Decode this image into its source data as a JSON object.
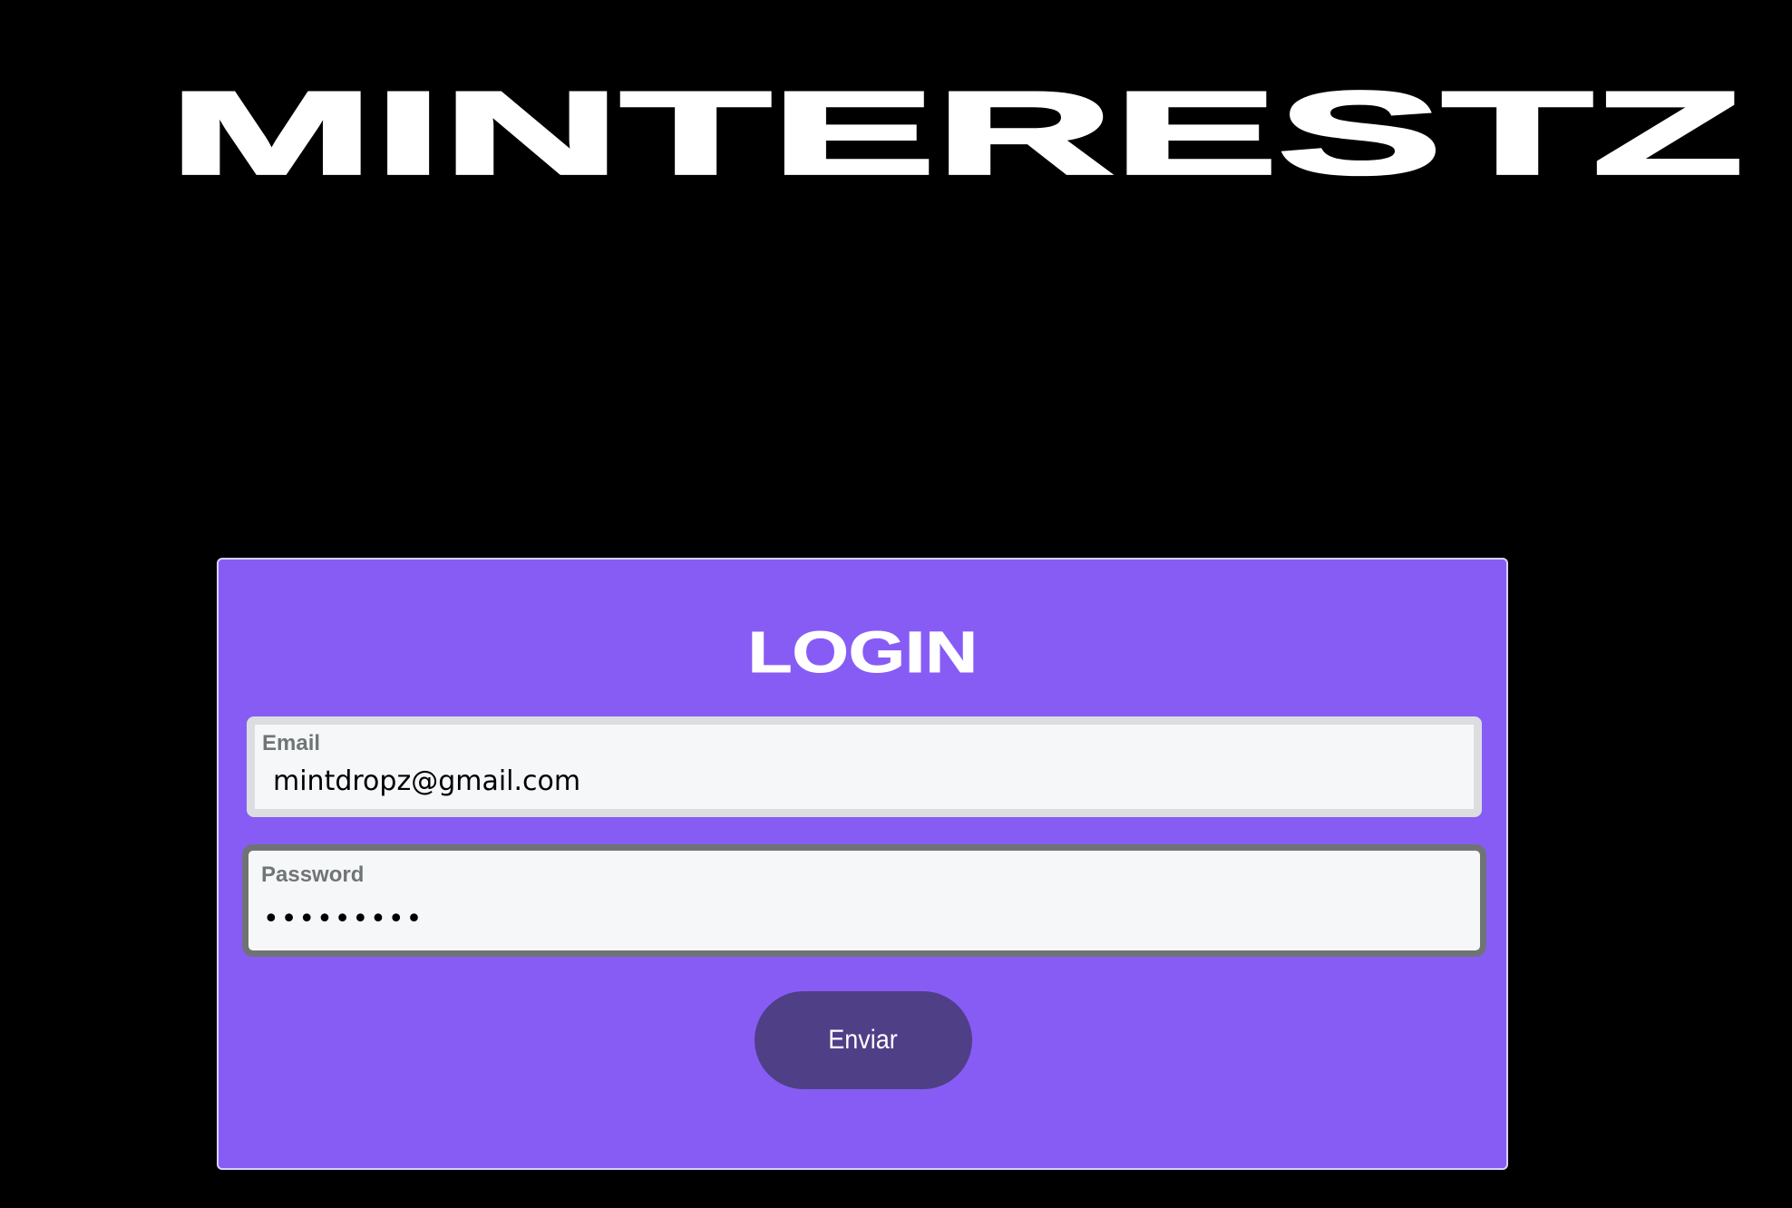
{
  "brand": {
    "name": "MINTERESTZ"
  },
  "login": {
    "title": "LOGIN",
    "email": {
      "label": "Email",
      "value": "mintdropz@gmail.com"
    },
    "password": {
      "label": "Password",
      "value": "•••••••••"
    },
    "submit_label": "Enviar"
  },
  "colors": {
    "background": "#000000",
    "card": "#875cf5",
    "button": "#4f3f87",
    "field_background": "#f6f7f9",
    "focused_border": "#6f7373"
  }
}
